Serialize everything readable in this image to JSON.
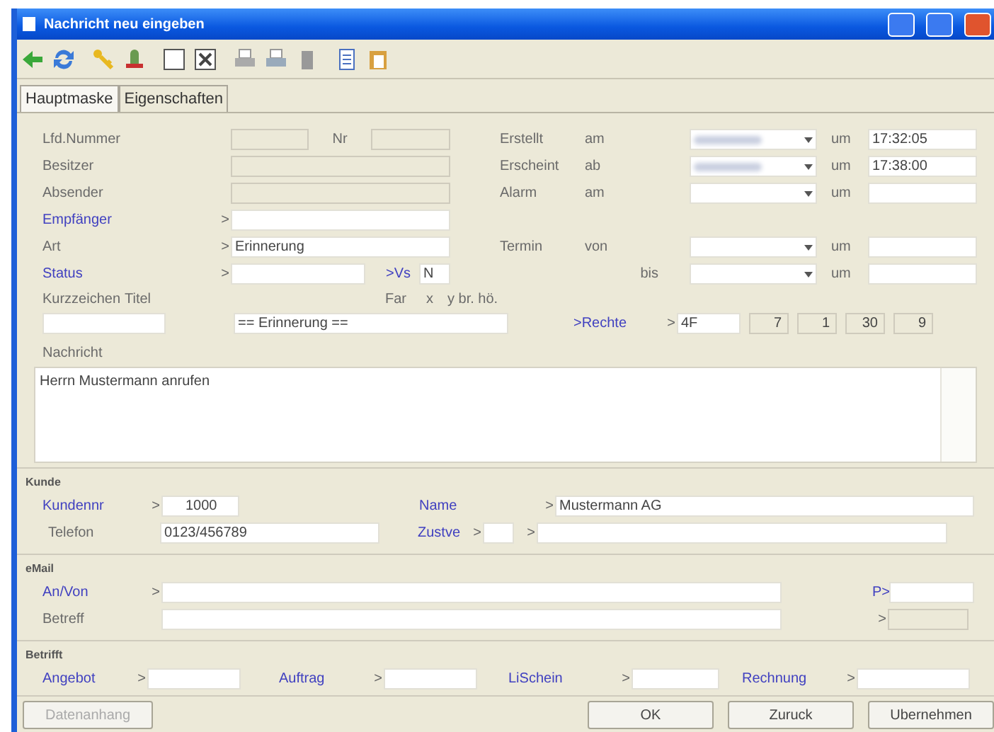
{
  "window": {
    "title": "Nachricht neu eingeben"
  },
  "tabs": [
    {
      "label": "Hauptmaske",
      "selected": true
    },
    {
      "label": "Eigenschaften",
      "selected": false
    }
  ],
  "header_left": [
    {
      "label": "Lfd.Nummer",
      "link": false,
      "kind": "readonly",
      "extra_label": "Nr"
    },
    {
      "label": "Besitzer",
      "link": false,
      "kind": "readonly"
    },
    {
      "label": "Absender",
      "link": false,
      "kind": "readonly"
    },
    {
      "label": "Empfänger",
      "link": true,
      "kind": "input",
      "prompt": ">"
    },
    {
      "label": "Art",
      "link": false,
      "kind": "input",
      "prompt": ">",
      "value": "Erinnerung"
    },
    {
      "label": "Status",
      "link": true,
      "kind": "status",
      "prompt": ">",
      "vs_label": ">Vs",
      "vs_value": "N"
    }
  ],
  "dates": [
    {
      "label": "Erstellt",
      "sub_label": "am",
      "date_obscured": true,
      "time_label": "um",
      "time": "17:32:05"
    },
    {
      "label": "Erscheint",
      "sub_label": "ab",
      "date_obscured": true,
      "time_label": "um",
      "time": "17:38:00"
    },
    {
      "label": "Alarm",
      "sub_label": "am",
      "date_obscured": false,
      "time_label": "um"
    }
  ],
  "appointment": [
    {
      "label": "Termin",
      "sub_label": "von",
      "date_obscured": false,
      "time_label": "um"
    },
    {
      "sub_label": "bis",
      "date_obscured": false,
      "time_label": "um"
    }
  ],
  "title_row": {
    "kurz_label": "Kurzzeichen",
    "titel_label": "Titel",
    "col_labels": [
      "Far",
      "x",
      "y br. hö."
    ],
    "titel_value": "== Erinnerung ==",
    "rechte_link": ">Rechte",
    "rechte_prompt": ">",
    "rechte_value": "4F",
    "values": [
      "7",
      "1",
      "30",
      "9"
    ]
  },
  "message": {
    "label": "Nachricht",
    "text": "Herrn Mustermann anrufen"
  },
  "customer": {
    "group": "Kunde",
    "kundennr": {
      "label": "Kundennr",
      "prompt": ">",
      "value": "1000"
    },
    "name": {
      "label": "Name",
      "prompt": ">",
      "value": "Mustermann AG"
    },
    "telefon": {
      "label": "Telefon",
      "value": "0123/456789"
    },
    "zustve": {
      "label": "Zustve",
      "prompt": ">",
      "prompt2": ">"
    }
  },
  "email": {
    "group": "eMail",
    "an_von": {
      "label": "An/Von",
      "prompt": ">"
    },
    "p_label": "P>",
    "betreff": {
      "label": "Betreff"
    },
    "betreff_prompt": ">"
  },
  "regarding": {
    "group": "Betrifft",
    "items": [
      {
        "label": "Angebot",
        "prompt": ">"
      },
      {
        "label": "Auftrag",
        "prompt": ">"
      },
      {
        "label": "LiSchein",
        "prompt": ">"
      },
      {
        "label": "Rechnung",
        "prompt": ">"
      }
    ]
  },
  "buttons": [
    {
      "label": "Datenanhang",
      "disabled": true
    },
    {
      "label": "OK",
      "disabled": false
    },
    {
      "label": "Zuruck",
      "disabled": false
    },
    {
      "label": "Ubernehmen",
      "disabled": false
    }
  ]
}
